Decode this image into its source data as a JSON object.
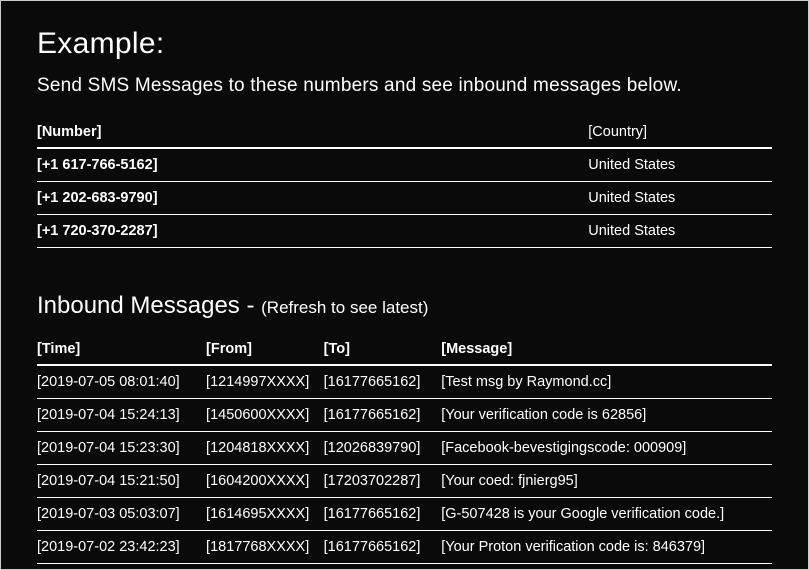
{
  "example": {
    "title": "Example:",
    "subtitle": "Send SMS Messages to these numbers and see inbound messages below.",
    "headers": {
      "number": "[Number]",
      "country": "[Country]"
    },
    "rows": [
      {
        "number": "[+1 617-766-5162]",
        "country": "United States"
      },
      {
        "number": "[+1 202-683-9790]",
        "country": "United States"
      },
      {
        "number": "[+1 720-370-2287]",
        "country": "United States"
      }
    ]
  },
  "inbound": {
    "title": "Inbound Messages - ",
    "hint": "(Refresh to see latest)",
    "headers": {
      "time": "[Time]",
      "from": "[From]",
      "to": "[To]",
      "message": "[Message]"
    },
    "rows": [
      {
        "time": "[2019-07-05 08:01:40]",
        "from": "[1214997XXXX]",
        "to": "[16177665162]",
        "message": "[Test msg by Raymond.cc]"
      },
      {
        "time": "[2019-07-04 15:24:13]",
        "from": "[1450600XXXX]",
        "to": "[16177665162]",
        "message": "[Your verification code is 62856]"
      },
      {
        "time": "[2019-07-04 15:23:30]",
        "from": "[1204818XXXX]",
        "to": "[12026839790]",
        "message": "[Facebook-bevestigingscode: 000909]"
      },
      {
        "time": "[2019-07-04 15:21:50]",
        "from": "[1604200XXXX]",
        "to": "[17203702287]",
        "message": "[Your coed: fjnierg95]"
      },
      {
        "time": "[2019-07-03 05:03:07]",
        "from": "[1614695XXXX]",
        "to": "[16177665162]",
        "message": "[G-507428 is your Google verification code.]"
      },
      {
        "time": "[2019-07-02 23:42:23]",
        "from": "[1817768XXXX]",
        "to": "[16177665162]",
        "message": "[Your Proton verification code is: 846379]"
      }
    ]
  }
}
